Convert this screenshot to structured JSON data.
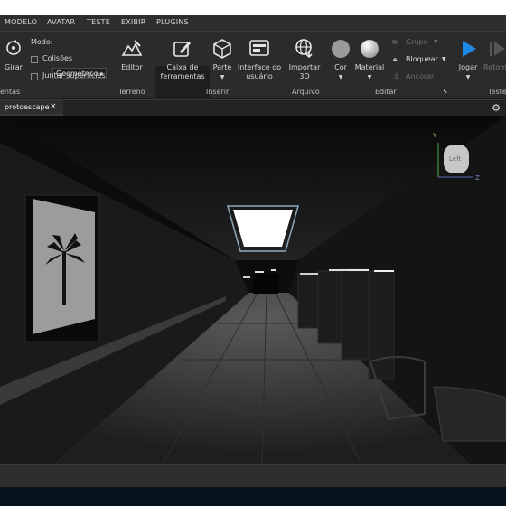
{
  "menubar": {
    "items": [
      "MODELO",
      "AVATAR",
      "TESTE",
      "EXIBIR",
      "PLUGINS"
    ]
  },
  "ribbon": {
    "rotate": {
      "label": "Girar"
    },
    "mode": {
      "label": "Modo:",
      "value": "Geométrico"
    },
    "collisions": {
      "label": "Colisões"
    },
    "join_surfaces": {
      "label": "Juntar superfícies"
    },
    "editor": {
      "label": "Editor"
    },
    "toolbox": {
      "line1": "Caixa de",
      "line2": "ferramentas"
    },
    "part": {
      "label": "Parte"
    },
    "ui": {
      "line1": "Interface do",
      "line2": "usuário"
    },
    "import3d": {
      "line1": "Importar",
      "line2": "3D"
    },
    "color": {
      "label": "Cor"
    },
    "material": {
      "label": "Material"
    },
    "group": {
      "label": "Grupo"
    },
    "lock": {
      "label": "Bloquear"
    },
    "anchor": {
      "label": "Ancorar"
    },
    "play": {
      "label": "Jogar"
    },
    "resume": {
      "label": "Retom"
    },
    "groups": {
      "tools": "entas",
      "terrain": "Terreno",
      "insert": "Inserir",
      "file": "Arquivo",
      "edit": "Editar",
      "test": "Teste"
    }
  },
  "tabs": [
    {
      "label": "protoescape",
      "close": "×"
    }
  ],
  "viewcube": {
    "face": "Left",
    "axis_y": "Y",
    "axis_z": "Z"
  },
  "colors": {
    "accent": "#1e88e5",
    "menubar": "#2e2e2e",
    "ribbon": "#2b2b2b",
    "viewport": "#0e0e0e"
  }
}
